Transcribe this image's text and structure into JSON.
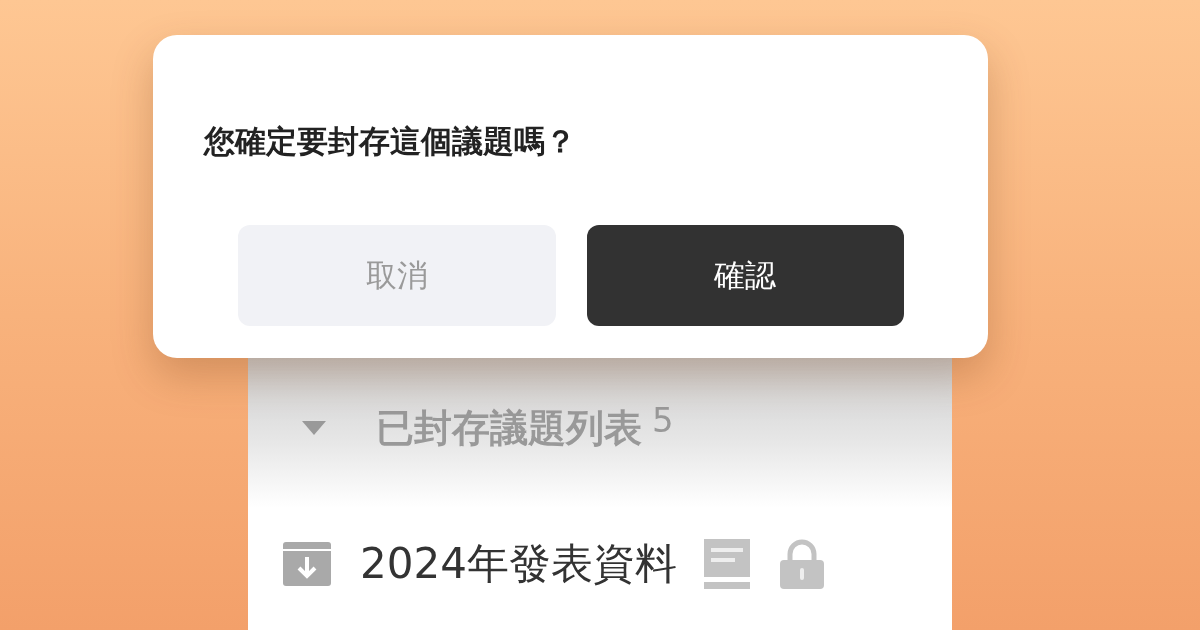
{
  "dialog": {
    "title": "您確定要封存這個議題嗎？",
    "buttons": [
      {
        "label": "取消",
        "kind": "secondary"
      },
      {
        "label": "確認",
        "kind": "primary"
      }
    ]
  },
  "archived_section": {
    "title": "已封存議題列表",
    "count": "5",
    "expanded": true,
    "items": [
      {
        "label": "2024年發表資料",
        "locked": true
      }
    ]
  }
}
